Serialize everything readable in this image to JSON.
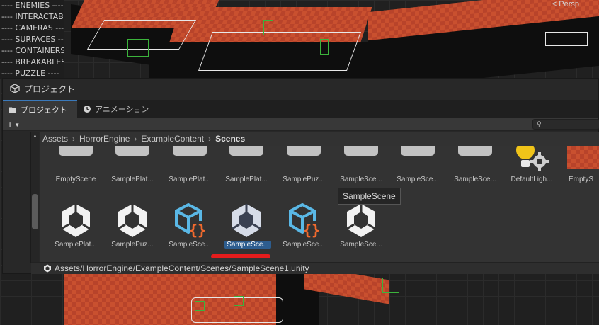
{
  "hierarchy": {
    "items": [
      "---- ENEMIES ----",
      "---- INTERACTABLES",
      "---- CAMERAS ----",
      "---- SURFACES ----",
      "---- CONTAINERS",
      "---- BREAKABLES",
      "---- PUZZLE ----"
    ]
  },
  "scene_view": {
    "persp_label": "< Persp"
  },
  "project_window": {
    "title": "プロジェクト",
    "tabs": [
      {
        "label": "プロジェクト",
        "icon": "folder-icon",
        "active": true
      },
      {
        "label": "アニメーション",
        "icon": "animation-clock-icon",
        "active": false
      }
    ],
    "toolbar": {
      "add_label": "+",
      "search_placeholder": ""
    },
    "breadcrumb": [
      "Assets",
      "HorrorEngine",
      "ExampleContent",
      "Scenes"
    ],
    "row1": [
      {
        "label": "EmptyScene",
        "icon": "folder-icon"
      },
      {
        "label": "SamplePlat...",
        "icon": "folder-icon"
      },
      {
        "label": "SamplePlat...",
        "icon": "folder-icon"
      },
      {
        "label": "SamplePlat...",
        "icon": "folder-icon"
      },
      {
        "label": "SamplePuz...",
        "icon": "folder-icon"
      },
      {
        "label": "SampleSce...",
        "icon": "folder-icon"
      },
      {
        "label": "SampleSce...",
        "icon": "folder-icon"
      },
      {
        "label": "SampleSce...",
        "icon": "folder-icon"
      },
      {
        "label": "DefaultLigh...",
        "icon": "lighting-settings-icon"
      },
      {
        "label": "EmptyS",
        "icon": "scene-preview-icon"
      }
    ],
    "row2": [
      {
        "label": "SamplePlat...",
        "icon": "unity-scene-icon"
      },
      {
        "label": "SamplePuz...",
        "icon": "unity-scene-icon"
      },
      {
        "label": "SampleSce...",
        "icon": "scene-template-icon"
      },
      {
        "label": "SampleSce...",
        "icon": "unity-scene-icon",
        "selected": true
      },
      {
        "label": "SampleSce...",
        "icon": "scene-template-icon"
      },
      {
        "label": "SampleSce...",
        "icon": "unity-scene-icon"
      }
    ],
    "tooltip": "SampleScene",
    "status_path": "Assets/HorrorEngine/ExampleContent/Scenes/SampleScene1.unity"
  },
  "colors": {
    "selection": "#2d5d8f",
    "annotation_underline": "#e51c1c",
    "tab_accent": "#3a79bb",
    "template_orange": "#f26a2e",
    "template_blue": "#5ab8e6"
  }
}
